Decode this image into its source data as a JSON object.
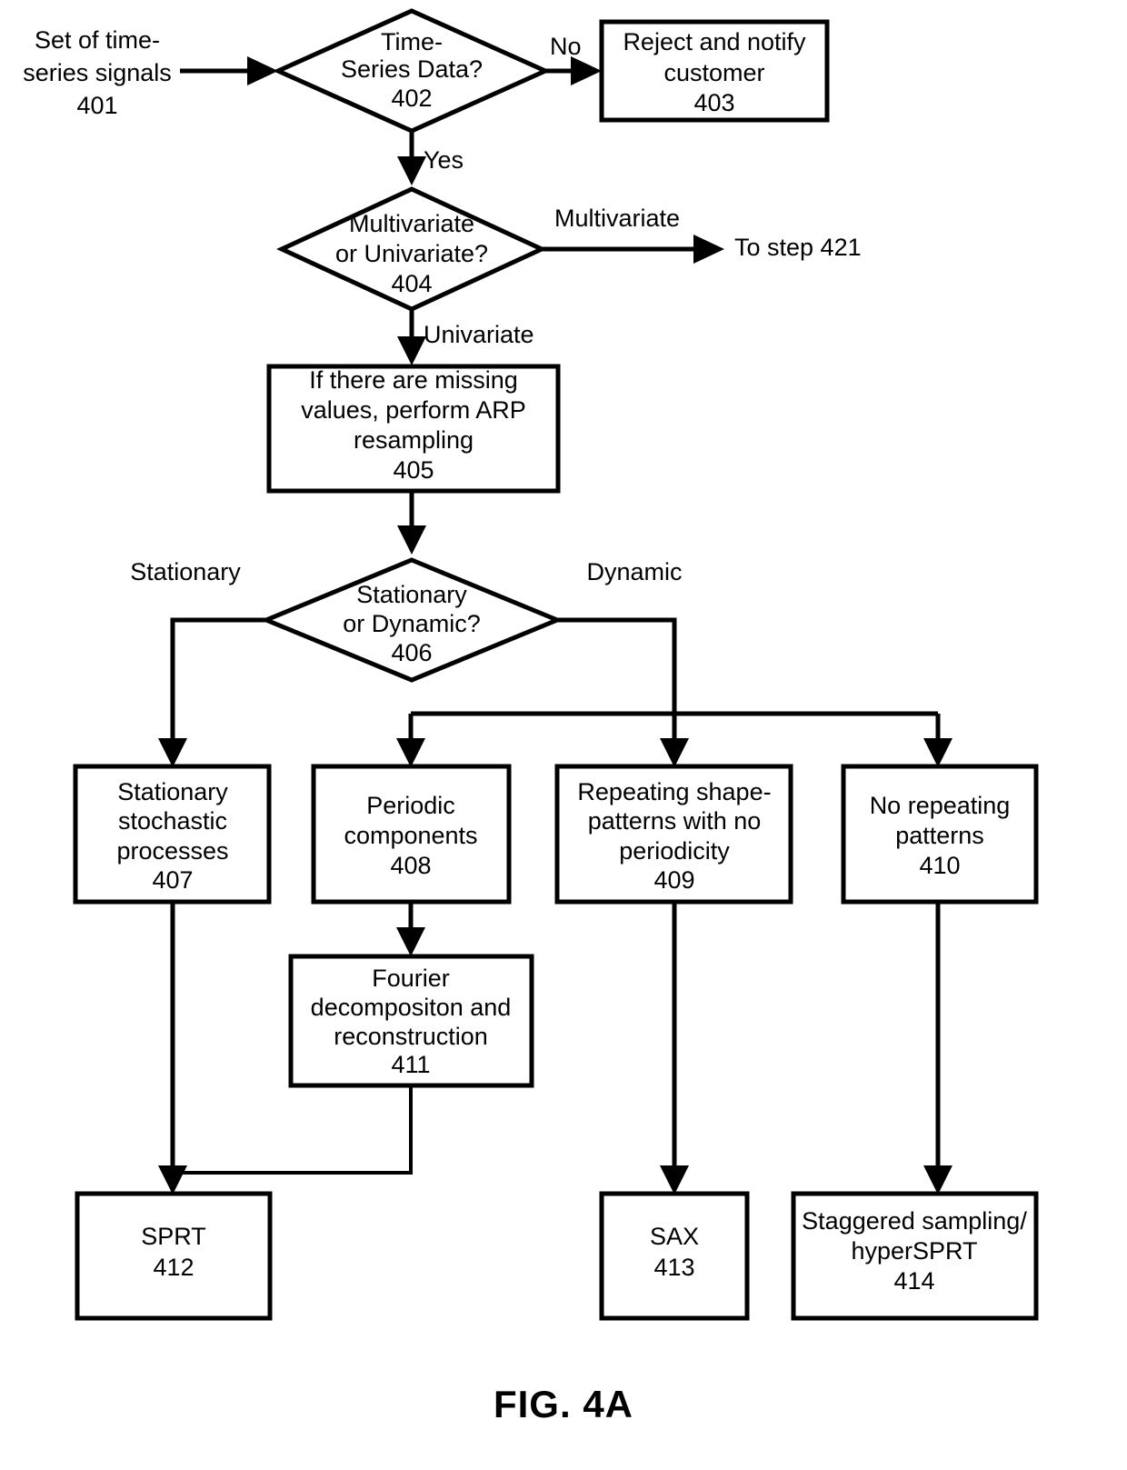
{
  "figure": {
    "caption": "FIG. 4A",
    "background_color": "#ffffff",
    "line_color": "#000000"
  },
  "chart_data": {
    "type": "diagram",
    "diagram_kind": "flowchart",
    "title": "FIG. 4A",
    "nodes": [
      {
        "id": "401",
        "shape": "label",
        "ref": "401",
        "lines": [
          "Set of time-",
          "series signals",
          "401"
        ]
      },
      {
        "id": "402",
        "shape": "diamond",
        "ref": "402",
        "lines": [
          "Time-",
          "Series Data?",
          "402"
        ]
      },
      {
        "id": "403",
        "shape": "rect",
        "ref": "403",
        "lines": [
          "Reject and notify",
          "customer",
          "403"
        ]
      },
      {
        "id": "404",
        "shape": "diamond",
        "ref": "404",
        "lines": [
          "Multivariate",
          "or Univariate?",
          "404"
        ]
      },
      {
        "id": "421",
        "shape": "label",
        "ref": "421",
        "lines": [
          "To step 421"
        ]
      },
      {
        "id": "405",
        "shape": "rect",
        "ref": "405",
        "lines": [
          "If there are missing",
          "values, perform ARP",
          "resampling",
          "405"
        ]
      },
      {
        "id": "406",
        "shape": "diamond",
        "ref": "406",
        "lines": [
          "Stationary",
          "or Dynamic?",
          "406"
        ]
      },
      {
        "id": "407",
        "shape": "rect",
        "ref": "407",
        "lines": [
          "Stationary",
          "stochastic",
          "processes",
          "407"
        ]
      },
      {
        "id": "408",
        "shape": "rect",
        "ref": "408",
        "lines": [
          "Periodic",
          "components",
          "408"
        ]
      },
      {
        "id": "409",
        "shape": "rect",
        "ref": "409",
        "lines": [
          "Repeating shape-",
          "patterns with no",
          "periodicity",
          "409"
        ]
      },
      {
        "id": "410",
        "shape": "rect",
        "ref": "410",
        "lines": [
          "No repeating",
          "patterns",
          "410"
        ]
      },
      {
        "id": "411",
        "shape": "rect",
        "ref": "411",
        "lines": [
          "Fourier",
          "decompositon and",
          "reconstruction",
          "411"
        ]
      },
      {
        "id": "412",
        "shape": "rect",
        "ref": "412",
        "lines": [
          "SPRT",
          "412"
        ]
      },
      {
        "id": "413",
        "shape": "rect",
        "ref": "413",
        "lines": [
          "SAX",
          "413"
        ]
      },
      {
        "id": "414",
        "shape": "rect",
        "ref": "414",
        "lines": [
          "Staggered sampling/",
          "hyperSPRT",
          "414"
        ]
      }
    ],
    "edges": [
      {
        "from": "401",
        "to": "402",
        "label": ""
      },
      {
        "from": "402",
        "to": "403",
        "label": "No"
      },
      {
        "from": "402",
        "to": "404",
        "label": "Yes"
      },
      {
        "from": "404",
        "to": "421",
        "label": "Multivariate"
      },
      {
        "from": "404",
        "to": "405",
        "label": "Univariate"
      },
      {
        "from": "405",
        "to": "406",
        "label": ""
      },
      {
        "from": "406",
        "to": "407",
        "label": "Stationary"
      },
      {
        "from": "406",
        "to": "408",
        "label": "Dynamic"
      },
      {
        "from": "406",
        "to": "409",
        "label": "Dynamic"
      },
      {
        "from": "406",
        "to": "410",
        "label": "Dynamic"
      },
      {
        "from": "408",
        "to": "411",
        "label": ""
      },
      {
        "from": "407",
        "to": "412",
        "label": ""
      },
      {
        "from": "411",
        "to": "412",
        "label": ""
      },
      {
        "from": "409",
        "to": "413",
        "label": ""
      },
      {
        "from": "410",
        "to": "414",
        "label": ""
      }
    ],
    "edge_labels": [
      {
        "id": "no",
        "text": "No"
      },
      {
        "id": "yes",
        "text": "Yes"
      },
      {
        "id": "multivariate",
        "text": "Multivariate"
      },
      {
        "id": "univariate",
        "text": "Univariate"
      },
      {
        "id": "stationary",
        "text": "Stationary"
      },
      {
        "id": "dynamic",
        "text": "Dynamic"
      }
    ]
  },
  "nodes": {
    "n401": {
      "line1": "Set of time-",
      "line2": "series signals",
      "line3": "401"
    },
    "n402": {
      "line1": "Time-",
      "line2": "Series Data?",
      "line3": "402"
    },
    "n403": {
      "line1": "Reject and notify",
      "line2": "customer",
      "line3": "403"
    },
    "n404": {
      "line1": "Multivariate",
      "line2": "or Univariate?",
      "line3": "404"
    },
    "n421": {
      "line1": "To step 421"
    },
    "n405": {
      "line1": "If there are missing",
      "line2": "values, perform ARP",
      "line3": "resampling",
      "line4": "405"
    },
    "n406": {
      "line1": "Stationary",
      "line2": "or Dynamic?",
      "line3": "406"
    },
    "n407": {
      "line1": "Stationary",
      "line2": "stochastic",
      "line3": "processes",
      "line4": "407"
    },
    "n408": {
      "line1": "Periodic",
      "line2": "components",
      "line3": "408"
    },
    "n409": {
      "line1": "Repeating shape-",
      "line2": "patterns with no",
      "line3": "periodicity",
      "line4": "409"
    },
    "n410": {
      "line1": "No repeating",
      "line2": "patterns",
      "line3": "410"
    },
    "n411": {
      "line1": "Fourier",
      "line2": "decompositon and",
      "line3": "reconstruction",
      "line4": "411"
    },
    "n412": {
      "line1": "SPRT",
      "line2": "412"
    },
    "n413": {
      "line1": "SAX",
      "line2": "413"
    },
    "n414": {
      "line1": "Staggered sampling/",
      "line2": "hyperSPRT",
      "line3": "414"
    }
  },
  "labels": {
    "no": "No",
    "yes": "Yes",
    "multivariate": "Multivariate",
    "univariate": "Univariate",
    "stationary": "Stationary",
    "dynamic": "Dynamic"
  },
  "caption": {
    "text": "FIG. 4A"
  }
}
